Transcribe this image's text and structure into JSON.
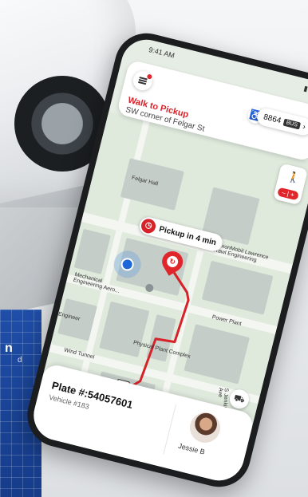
{
  "status_bar": {
    "time": "9:41 AM",
    "signal": "▮▮▮"
  },
  "trip": {
    "title": "Walk to Pickup",
    "subtitle": "SW corner of Felgar St",
    "vehicle_number": "8864",
    "bus_icon": "bus-icon",
    "zoom_label": "– | +"
  },
  "map": {
    "pickup_bubble": "Pickup in 4 min",
    "labels": [
      "Felgar Hall",
      "ExxonMobil Lawrence Rawl Engineering",
      "Mechanical Engineering Aero...",
      "Power Plant",
      "Physical Plant Complex",
      "Wind Tunnel",
      "Engineer",
      "S Jenkins Ave"
    ]
  },
  "sheet": {
    "plate": "Plate #:54057601",
    "vehicle": "Vehicle #183",
    "driver": "Jessie B"
  },
  "background": {
    "poster_line1": "n",
    "poster_line2": "d"
  }
}
